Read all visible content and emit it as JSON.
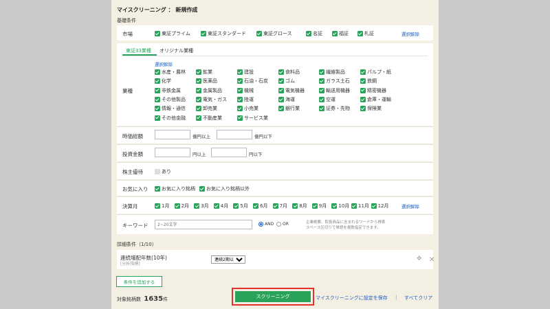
{
  "title": "マイスクリーニング ： 新規作成",
  "basic_conditions_label": "基礎条件",
  "market": {
    "label": "市場",
    "options": [
      "東証プライム",
      "東証スタンダード",
      "東証グロース",
      "名証",
      "福証",
      "札証"
    ],
    "select_all": "選択解除"
  },
  "tabs": {
    "active": "東証33業種",
    "other": "オリジナル業種"
  },
  "industry": {
    "label": "業種",
    "select_all": "選択解除",
    "options": [
      "水産・農林",
      "鉱業",
      "建設",
      "食料品",
      "繊維製品",
      "パルプ・紙",
      "化学",
      "医薬品",
      "石油・石炭",
      "ゴム",
      "ガラス土石",
      "鉄鋼",
      "非鉄金属",
      "金属製品",
      "機械",
      "電気機器",
      "輸送用機器",
      "精密機器",
      "その他製品",
      "電気・ガス",
      "陸運",
      "海運",
      "空運",
      "倉庫・運輸",
      "情報・通信",
      "卸売業",
      "小売業",
      "銀行業",
      "証券・先物",
      "保険業",
      "その他金融",
      "不動産業",
      "サービス業"
    ]
  },
  "market_cap": {
    "label": "時価総額",
    "from_unit": "億円以上",
    "to_unit": "億円以下"
  },
  "investment": {
    "label": "投資金額",
    "from_unit": "円以上",
    "to_unit": "円以下"
  },
  "shareholder": {
    "label": "株主優待",
    "option": "あり"
  },
  "favorites": {
    "label": "お気に入り",
    "options": [
      "お気に入り銘柄",
      "お気に入り銘柄以外"
    ]
  },
  "fiscal_month": {
    "label": "決算月",
    "options": [
      "1月",
      "2月",
      "3月",
      "4月",
      "5月",
      "6月",
      "7月",
      "8月",
      "9月",
      "10月",
      "11月",
      "12月"
    ],
    "select_all": "選択解除"
  },
  "keyword": {
    "label": "キーワード",
    "placeholder": "2~20文字",
    "and": "AND",
    "or": "OR",
    "note1": "企業概要、取扱商品に含まれるワードから検索",
    "note2": "スペース区切りで単語を複数指定できます。"
  },
  "detail_label": "詳細条件（1/10）",
  "detail_item": {
    "name": "連続増配年数(10年)",
    "sub": "[分析指標]",
    "value": "連続2期以上"
  },
  "add_condition": "条件を追加する",
  "result": {
    "label": "対象銘柄数",
    "count": "1635",
    "unit": "件"
  },
  "screening_button": "スクリーニング",
  "save_link": "マイスクリーニングに設定を保存",
  "divider": "|",
  "clear_link": "すべてクリア"
}
